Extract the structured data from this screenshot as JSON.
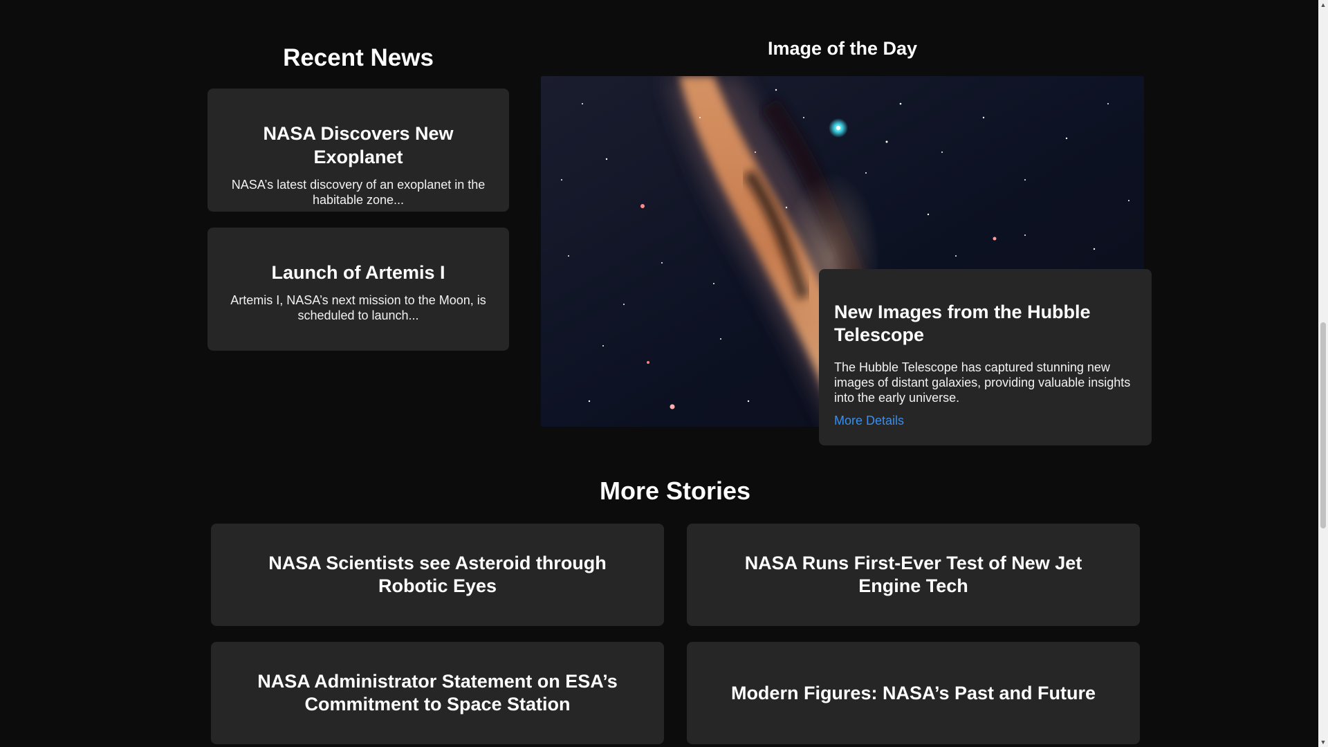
{
  "recent_news": {
    "heading": "Recent News",
    "items": [
      {
        "title": "NASA Discovers New Exoplanet",
        "summary": "NASA’s latest discovery of an exoplanet in the habitable zone..."
      },
      {
        "title": "Launch of Artemis I",
        "summary": "Artemis I, NASA’s next mission to the Moon, is scheduled to launch..."
      }
    ]
  },
  "image_of_the_day": {
    "heading": "Image of the Day",
    "image_icon": "milky-way-image",
    "card": {
      "title": "New Images from the Hubble Telescope",
      "description": "The Hubble Telescope has captured stunning new images of distant galaxies, providing valuable insights into the early universe.",
      "link_label": "More Details",
      "link_color": "#3b8eea"
    }
  },
  "more_stories": {
    "heading": "More Stories",
    "items": [
      {
        "title": "NASA Scientists see Asteroid through Robotic Eyes"
      },
      {
        "title": "NASA Runs First-Ever Test of New Jet Engine Tech"
      },
      {
        "title": "NASA Administrator Statement on ESA’s Commitment to Space Station"
      },
      {
        "title": "Modern Figures: NASA’s Past and Future"
      }
    ]
  },
  "scrollbar": {
    "up_icon": "scroll-up-arrow-icon",
    "down_icon": "scroll-down-arrow-icon"
  },
  "colors": {
    "background": "#0c0c0c",
    "card": "#262626",
    "text": "#ffffff",
    "link": "#3b8eea"
  }
}
